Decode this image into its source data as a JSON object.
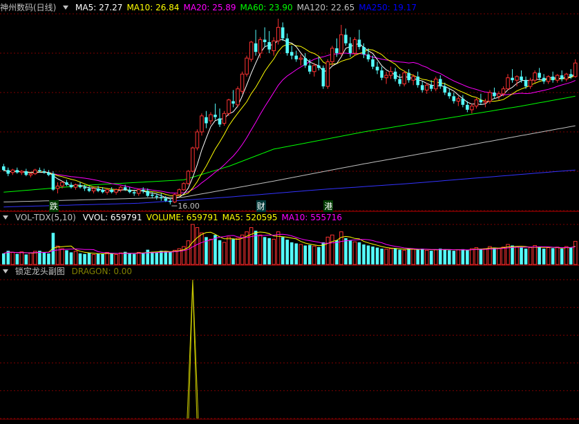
{
  "main": {
    "stock_title": "神州数码(日线)",
    "ma_labels": [
      {
        "text": "MA5: 27.27",
        "color": "#ffffff"
      },
      {
        "text": "MA10: 26.84",
        "color": "#ffff00"
      },
      {
        "text": "MA20: 25.89",
        "color": "#ff00ff"
      },
      {
        "text": "MA60: 23.90",
        "color": "#00ff00"
      },
      {
        "text": "MA120: 22.65",
        "color": "#c0c0c0"
      },
      {
        "text": "MA250: 19.17",
        "color": "#0000ff"
      }
    ],
    "low_marker": "16.00",
    "event_tags": [
      {
        "text": "跌",
        "color": "#00cc00",
        "candle": 11
      },
      {
        "text": "财",
        "color": "#00cccc",
        "candle": 57
      },
      {
        "text": "港",
        "color": "#00cc00",
        "candle": 72
      }
    ]
  },
  "volume": {
    "indicator_name": "VOL-TDX(5,10)",
    "values": [
      {
        "text": "VVOL: 659791",
        "color": "#ffffff"
      },
      {
        "text": "VOLUME: 659791",
        "color": "#ffff00"
      },
      {
        "text": "MA5: 520595",
        "color": "#ffff00"
      },
      {
        "text": "MA10: 555716",
        "color": "#ff00ff"
      }
    ]
  },
  "sub": {
    "indicator_name": "锁定龙头副图",
    "value_text": "DRAGON: 0.00"
  },
  "colors": {
    "up": "#ff3232",
    "down": "#54fcfc",
    "grid": "#800000",
    "ma5": "#ffffff",
    "ma10": "#ffff00",
    "ma20": "#ff00ff",
    "ma60": "#00ff00",
    "ma120": "#c0c0c0",
    "ma250": "#3333ff",
    "dragon": "#c8c800"
  },
  "chart_data": [
    {
      "type": "candlestick",
      "ylim": [
        15.5,
        31.5
      ],
      "candles": [
        [
          19.1,
          19.3,
          18.7,
          18.8
        ],
        [
          18.8,
          19.0,
          18.3,
          18.5
        ],
        [
          18.6,
          18.9,
          18.4,
          18.8
        ],
        [
          18.8,
          19.0,
          18.5,
          18.6
        ],
        [
          18.6,
          18.8,
          18.4,
          18.7
        ],
        [
          18.7,
          18.9,
          18.3,
          18.4
        ],
        [
          18.4,
          18.6,
          18.2,
          18.5
        ],
        [
          18.5,
          18.9,
          18.4,
          18.8
        ],
        [
          18.8,
          19.0,
          18.6,
          18.7
        ],
        [
          18.7,
          18.9,
          18.5,
          18.6
        ],
        [
          18.6,
          18.8,
          18.3,
          18.4
        ],
        [
          18.5,
          18.7,
          17.1,
          17.2
        ],
        [
          17.3,
          17.8,
          16.9,
          17.5
        ],
        [
          17.5,
          17.9,
          17.3,
          17.8
        ],
        [
          17.8,
          18.0,
          17.5,
          17.6
        ],
        [
          17.6,
          17.8,
          17.3,
          17.4
        ],
        [
          17.4,
          17.7,
          17.2,
          17.6
        ],
        [
          17.5,
          17.8,
          17.3,
          17.4
        ],
        [
          17.4,
          17.6,
          17.1,
          17.3
        ],
        [
          17.3,
          17.5,
          17.0,
          17.1
        ],
        [
          17.1,
          17.4,
          16.9,
          17.3
        ],
        [
          17.3,
          17.5,
          17.0,
          17.1
        ],
        [
          17.2,
          17.4,
          16.9,
          17.0
        ],
        [
          17.0,
          17.3,
          16.8,
          17.2
        ],
        [
          17.2,
          17.4,
          16.9,
          17.0
        ],
        [
          17.0,
          17.3,
          16.8,
          17.2
        ],
        [
          17.2,
          17.5,
          17.0,
          17.4
        ],
        [
          17.4,
          17.6,
          17.1,
          17.2
        ],
        [
          17.2,
          17.4,
          16.9,
          17.0
        ],
        [
          17.0,
          17.2,
          16.7,
          16.9
        ],
        [
          16.9,
          17.3,
          16.7,
          17.2
        ],
        [
          17.2,
          17.4,
          16.9,
          17.1
        ],
        [
          17.1,
          17.3,
          16.6,
          16.7
        ],
        [
          16.8,
          17.0,
          16.5,
          16.7
        ],
        [
          16.7,
          16.9,
          16.4,
          16.6
        ],
        [
          16.6,
          16.9,
          16.3,
          16.5
        ],
        [
          16.5,
          16.7,
          16.2,
          16.3
        ],
        [
          16.3,
          16.5,
          16.0,
          16.2
        ],
        [
          16.2,
          16.9,
          16.1,
          16.8
        ],
        [
          16.8,
          17.3,
          16.7,
          17.2
        ],
        [
          17.2,
          17.8,
          17.1,
          17.7
        ],
        [
          17.7,
          18.8,
          17.6,
          18.7
        ],
        [
          18.7,
          20.7,
          18.6,
          20.6
        ],
        [
          20.6,
          22.1,
          20.4,
          21.9
        ],
        [
          21.9,
          23.4,
          21.6,
          23.2
        ],
        [
          23.1,
          23.6,
          22.2,
          22.6
        ],
        [
          22.8,
          23.5,
          22.5,
          23.3
        ],
        [
          23.3,
          24.2,
          22.9,
          23.1
        ],
        [
          23.0,
          23.8,
          22.3,
          22.5
        ],
        [
          22.6,
          23.6,
          22.4,
          23.4
        ],
        [
          23.4,
          24.6,
          23.2,
          24.5
        ],
        [
          24.4,
          25.3,
          23.9,
          24.2
        ],
        [
          24.1,
          25.6,
          23.9,
          25.4
        ],
        [
          25.2,
          26.8,
          25.0,
          26.6
        ],
        [
          26.6,
          28.1,
          26.4,
          27.9
        ],
        [
          27.8,
          29.3,
          27.6,
          29.2
        ],
        [
          29.1,
          30.2,
          28.1,
          28.4
        ],
        [
          28.3,
          29.6,
          27.9,
          29.4
        ],
        [
          29.4,
          30.4,
          28.8,
          29.2
        ],
        [
          29.2,
          30.1,
          28.3,
          28.6
        ],
        [
          28.5,
          29.6,
          28.1,
          29.3
        ],
        [
          29.3,
          31.1,
          29.0,
          30.4
        ],
        [
          30.4,
          30.8,
          29.3,
          29.5
        ],
        [
          29.5,
          29.9,
          28.1,
          28.3
        ],
        [
          28.4,
          28.9,
          27.8,
          28.1
        ],
        [
          28.1,
          28.5,
          27.6,
          27.8
        ],
        [
          27.8,
          28.2,
          27.3,
          27.9
        ],
        [
          27.9,
          28.3,
          27.1,
          27.3
        ],
        [
          27.3,
          27.8,
          26.6,
          26.8
        ],
        [
          26.8,
          27.5,
          26.4,
          27.3
        ],
        [
          27.3,
          28.0,
          26.9,
          27.1
        ],
        [
          27.1,
          27.3,
          25.4,
          25.6
        ],
        [
          25.6,
          27.8,
          25.4,
          27.6
        ],
        [
          27.6,
          28.9,
          27.3,
          28.7
        ],
        [
          28.7,
          29.5,
          28.0,
          28.3
        ],
        [
          28.3,
          30.6,
          28.1,
          29.8
        ],
        [
          29.8,
          30.3,
          28.9,
          29.1
        ],
        [
          29.1,
          29.6,
          28.0,
          28.3
        ],
        [
          28.3,
          29.6,
          28.1,
          29.4
        ],
        [
          29.4,
          30.2,
          28.6,
          28.8
        ],
        [
          28.8,
          29.1,
          27.9,
          28.2
        ],
        [
          28.2,
          28.7,
          27.6,
          27.8
        ],
        [
          27.8,
          28.1,
          27.0,
          27.2
        ],
        [
          27.2,
          27.6,
          26.6,
          26.9
        ],
        [
          26.9,
          27.2,
          26.1,
          26.3
        ],
        [
          26.3,
          26.8,
          25.8,
          26.5
        ],
        [
          26.5,
          27.2,
          26.2,
          26.8
        ],
        [
          26.8,
          27.1,
          26.0,
          26.2
        ],
        [
          26.2,
          26.6,
          25.6,
          25.8
        ],
        [
          25.8,
          26.9,
          25.6,
          26.7
        ],
        [
          26.7,
          27.0,
          25.9,
          26.1
        ],
        [
          26.1,
          26.6,
          25.7,
          26.4
        ],
        [
          26.4,
          26.8,
          25.5,
          25.7
        ],
        [
          25.7,
          26.0,
          25.1,
          25.3
        ],
        [
          25.3,
          25.9,
          25.0,
          25.7
        ],
        [
          25.7,
          26.1,
          25.2,
          25.4
        ],
        [
          25.4,
          26.4,
          25.2,
          26.2
        ],
        [
          26.2,
          26.5,
          25.4,
          25.6
        ],
        [
          25.6,
          25.9,
          24.9,
          25.1
        ],
        [
          25.1,
          25.4,
          24.6,
          24.8
        ],
        [
          24.8,
          25.1,
          24.2,
          24.4
        ],
        [
          24.4,
          24.8,
          24.0,
          24.6
        ],
        [
          24.6,
          24.9,
          23.9,
          24.1
        ],
        [
          24.1,
          24.4,
          23.5,
          23.7
        ],
        [
          23.7,
          24.2,
          23.4,
          24.0
        ],
        [
          24.0,
          24.7,
          23.8,
          24.5
        ],
        [
          24.5,
          25.0,
          24.1,
          24.3
        ],
        [
          24.3,
          24.6,
          23.9,
          24.4
        ],
        [
          24.4,
          25.3,
          24.2,
          25.1
        ],
        [
          25.1,
          25.5,
          24.6,
          24.8
        ],
        [
          24.8,
          25.2,
          24.5,
          25.0
        ],
        [
          25.0,
          25.6,
          24.8,
          25.4
        ],
        [
          25.4,
          26.6,
          25.3,
          26.3
        ],
        [
          26.3,
          27.0,
          25.9,
          26.1
        ],
        [
          26.1,
          26.5,
          25.6,
          26.4
        ],
        [
          26.4,
          26.9,
          25.9,
          26.1
        ],
        [
          26.1,
          26.4,
          25.4,
          25.6
        ],
        [
          25.6,
          26.3,
          25.4,
          26.1
        ],
        [
          26.1,
          26.9,
          25.9,
          26.7
        ],
        [
          26.7,
          27.1,
          26.1,
          26.3
        ],
        [
          26.3,
          26.6,
          25.8,
          26.0
        ],
        [
          26.0,
          26.5,
          25.8,
          26.4
        ],
        [
          26.4,
          26.8,
          25.9,
          26.1
        ],
        [
          26.1,
          26.6,
          25.9,
          26.5
        ],
        [
          26.5,
          26.9,
          26.0,
          26.2
        ],
        [
          26.2,
          26.7,
          26.0,
          26.6
        ],
        [
          26.6,
          27.0,
          26.2,
          26.4
        ],
        [
          26.4,
          27.8,
          26.3,
          27.5
        ]
      ],
      "ma60": [
        [
          0,
          17.0
        ],
        [
          20,
          17.6
        ],
        [
          40,
          18.0
        ],
        [
          50,
          19.1
        ],
        [
          60,
          20.5
        ],
        [
          80,
          21.9
        ],
        [
          100,
          23.1
        ],
        [
          115,
          24.0
        ],
        [
          127,
          24.8
        ]
      ],
      "ma120": [
        [
          0,
          16.2
        ],
        [
          40,
          16.6
        ],
        [
          60,
          17.9
        ],
        [
          80,
          19.3
        ],
        [
          100,
          20.6
        ],
        [
          115,
          21.6
        ],
        [
          127,
          22.4
        ]
      ],
      "ma250": [
        [
          0,
          15.8
        ],
        [
          30,
          16.1
        ],
        [
          50,
          16.6
        ],
        [
          70,
          17.2
        ],
        [
          90,
          17.7
        ],
        [
          110,
          18.3
        ],
        [
          127,
          18.8
        ]
      ]
    },
    {
      "type": "bar",
      "volumes": [
        210,
        260,
        230,
        200,
        240,
        190,
        220,
        250,
        260,
        230,
        210,
        600,
        350,
        300,
        270,
        230,
        250,
        210,
        200,
        220,
        190,
        210,
        200,
        230,
        210,
        190,
        220,
        240,
        210,
        200,
        230,
        220,
        280,
        240,
        230,
        260,
        250,
        240,
        270,
        300,
        340,
        450,
        760,
        700,
        600,
        520,
        480,
        560,
        460,
        420,
        520,
        480,
        500,
        560,
        620,
        700,
        640,
        560,
        520,
        500,
        480,
        620,
        520,
        470,
        420,
        400,
        380,
        360,
        370,
        350,
        330,
        420,
        520,
        560,
        460,
        620,
        500,
        460,
        430,
        420,
        380,
        360,
        340,
        320,
        300,
        290,
        300,
        310,
        280,
        270,
        300,
        290,
        280,
        300,
        270,
        260,
        280,
        300,
        290,
        270,
        260,
        280,
        290,
        270,
        300,
        320,
        290,
        300,
        340,
        320,
        300,
        330,
        380,
        360,
        340,
        320,
        300,
        320,
        360,
        340,
        300,
        320,
        310,
        330,
        300,
        340,
        320,
        440
      ]
    },
    {
      "type": "line",
      "name": "DRAGON",
      "peak_index": 42,
      "peak_value": 1,
      "ylim": [
        0,
        1
      ]
    }
  ]
}
